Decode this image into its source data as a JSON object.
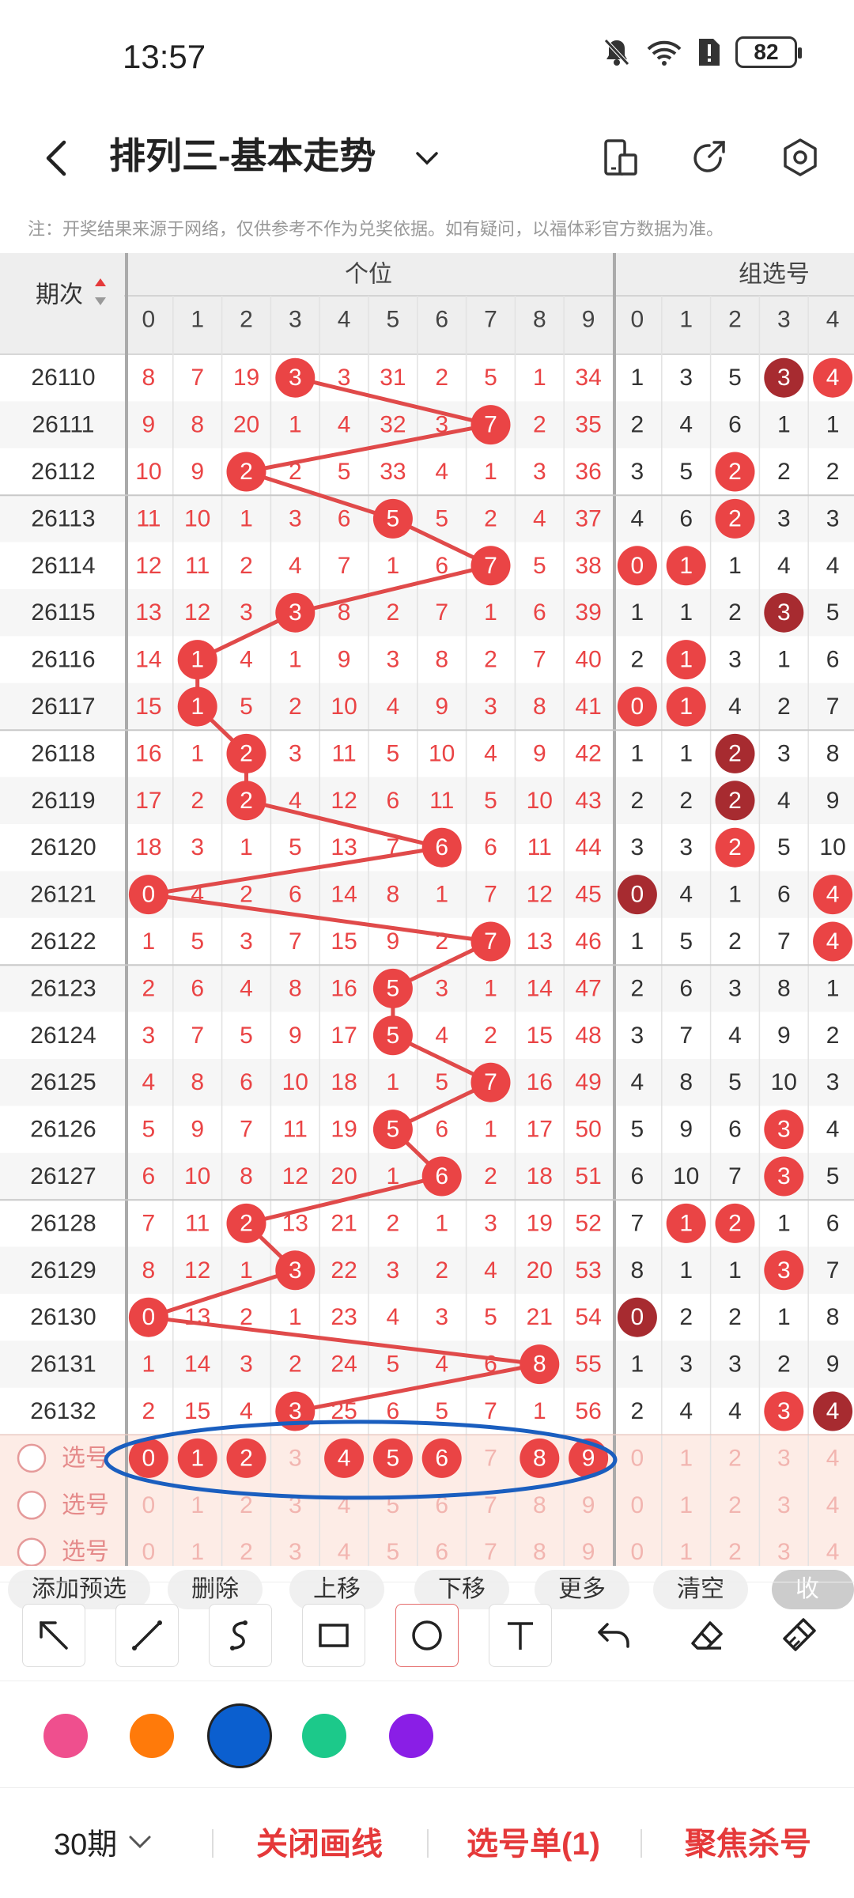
{
  "status": {
    "time": "13:57",
    "battery": "82"
  },
  "header": {
    "title": "排列三-基本走势"
  },
  "note": "注：开奖结果来源于网络，仅供参考不作为兑奖依据。如有疑问，以福体彩官方数据为准。",
  "table": {
    "period_header": "期次",
    "group_units": "个位",
    "group_combo": "组选号",
    "digit_headers": [
      "0",
      "1",
      "2",
      "3",
      "4",
      "5",
      "6",
      "7",
      "8",
      "9"
    ],
    "combo_headers": [
      "0",
      "1",
      "2",
      "3",
      "4"
    ],
    "rows": [
      {
        "period": "26110",
        "units": [
          "8",
          "7",
          "19",
          "3",
          "3",
          "31",
          "2",
          "5",
          "1",
          "34"
        ],
        "hit": 3,
        "combo": [
          "1",
          "3",
          "5",
          "3",
          "4"
        ],
        "combo_hits": [
          3,
          4
        ],
        "combo_dark": [
          3
        ]
      },
      {
        "period": "26111",
        "units": [
          "9",
          "8",
          "20",
          "1",
          "4",
          "32",
          "3",
          "7",
          "2",
          "35"
        ],
        "hit": 7,
        "combo": [
          "2",
          "4",
          "6",
          "1",
          "1"
        ],
        "combo_hits": [],
        "combo_dark": []
      },
      {
        "period": "26112",
        "units": [
          "10",
          "9",
          "2",
          "2",
          "5",
          "33",
          "4",
          "1",
          "3",
          "36"
        ],
        "hit": 2,
        "combo": [
          "3",
          "5",
          "2",
          "2",
          "2"
        ],
        "combo_hits": [
          2
        ],
        "combo_dark": []
      },
      {
        "period": "26113",
        "units": [
          "11",
          "10",
          "1",
          "3",
          "6",
          "5",
          "5",
          "2",
          "4",
          "37"
        ],
        "hit": 5,
        "combo": [
          "4",
          "6",
          "2",
          "3",
          "3"
        ],
        "combo_hits": [
          2
        ],
        "combo_dark": []
      },
      {
        "period": "26114",
        "units": [
          "12",
          "11",
          "2",
          "4",
          "7",
          "1",
          "6",
          "7",
          "5",
          "38"
        ],
        "hit": 7,
        "combo": [
          "0",
          "1",
          "1",
          "4",
          "4"
        ],
        "combo_hits": [
          0,
          1
        ],
        "combo_dark": []
      },
      {
        "period": "26115",
        "units": [
          "13",
          "12",
          "3",
          "3",
          "8",
          "2",
          "7",
          "1",
          "6",
          "39"
        ],
        "hit": 3,
        "combo": [
          "1",
          "1",
          "2",
          "3",
          "5"
        ],
        "combo_hits": [
          3
        ],
        "combo_dark": [
          3
        ]
      },
      {
        "period": "26116",
        "units": [
          "14",
          "1",
          "4",
          "1",
          "9",
          "3",
          "8",
          "2",
          "7",
          "40"
        ],
        "hit": 1,
        "combo": [
          "2",
          "1",
          "3",
          "1",
          "6"
        ],
        "combo_hits": [
          1
        ],
        "combo_dark": []
      },
      {
        "period": "26117",
        "units": [
          "15",
          "1",
          "5",
          "2",
          "10",
          "4",
          "9",
          "3",
          "8",
          "41"
        ],
        "hit": 1,
        "combo": [
          "0",
          "1",
          "4",
          "2",
          "7"
        ],
        "combo_hits": [
          0,
          1
        ],
        "combo_dark": []
      },
      {
        "period": "26118",
        "units": [
          "16",
          "1",
          "2",
          "3",
          "11",
          "5",
          "10",
          "4",
          "9",
          "42"
        ],
        "hit": 2,
        "combo": [
          "1",
          "1",
          "2",
          "3",
          "8"
        ],
        "combo_hits": [
          2
        ],
        "combo_dark": [
          2
        ]
      },
      {
        "period": "26119",
        "units": [
          "17",
          "2",
          "2",
          "4",
          "12",
          "6",
          "11",
          "5",
          "10",
          "43"
        ],
        "hit": 2,
        "combo": [
          "2",
          "2",
          "2",
          "4",
          "9"
        ],
        "combo_hits": [
          2
        ],
        "combo_dark": [
          2
        ]
      },
      {
        "period": "26120",
        "units": [
          "18",
          "3",
          "1",
          "5",
          "13",
          "7",
          "6",
          "6",
          "11",
          "44"
        ],
        "hit": 6,
        "combo": [
          "3",
          "3",
          "2",
          "5",
          "10"
        ],
        "combo_hits": [
          2
        ],
        "combo_dark": []
      },
      {
        "period": "26121",
        "units": [
          "0",
          "4",
          "2",
          "6",
          "14",
          "8",
          "1",
          "7",
          "12",
          "45"
        ],
        "hit": 0,
        "combo": [
          "0",
          "4",
          "1",
          "6",
          "4"
        ],
        "combo_hits": [
          0,
          4
        ],
        "combo_dark": [
          0
        ]
      },
      {
        "period": "26122",
        "units": [
          "1",
          "5",
          "3",
          "7",
          "15",
          "9",
          "2",
          "7",
          "13",
          "46"
        ],
        "hit": 7,
        "combo": [
          "1",
          "5",
          "2",
          "7",
          "4"
        ],
        "combo_hits": [
          4
        ],
        "combo_dark": []
      },
      {
        "period": "26123",
        "units": [
          "2",
          "6",
          "4",
          "8",
          "16",
          "5",
          "3",
          "1",
          "14",
          "47"
        ],
        "hit": 5,
        "combo": [
          "2",
          "6",
          "3",
          "8",
          "1"
        ],
        "combo_hits": [],
        "combo_dark": []
      },
      {
        "period": "26124",
        "units": [
          "3",
          "7",
          "5",
          "9",
          "17",
          "5",
          "4",
          "2",
          "15",
          "48"
        ],
        "hit": 5,
        "combo": [
          "3",
          "7",
          "4",
          "9",
          "2"
        ],
        "combo_hits": [],
        "combo_dark": []
      },
      {
        "period": "26125",
        "units": [
          "4",
          "8",
          "6",
          "10",
          "18",
          "1",
          "5",
          "7",
          "16",
          "49"
        ],
        "hit": 7,
        "combo": [
          "4",
          "8",
          "5",
          "10",
          "3"
        ],
        "combo_hits": [],
        "combo_dark": []
      },
      {
        "period": "26126",
        "units": [
          "5",
          "9",
          "7",
          "11",
          "19",
          "5",
          "6",
          "1",
          "17",
          "50"
        ],
        "hit": 5,
        "combo": [
          "5",
          "9",
          "6",
          "3",
          "4"
        ],
        "combo_hits": [
          3
        ],
        "combo_dark": []
      },
      {
        "period": "26127",
        "units": [
          "6",
          "10",
          "8",
          "12",
          "20",
          "1",
          "6",
          "2",
          "18",
          "51"
        ],
        "hit": 6,
        "combo": [
          "6",
          "10",
          "7",
          "3",
          "5"
        ],
        "combo_hits": [
          3
        ],
        "combo_dark": []
      },
      {
        "period": "26128",
        "units": [
          "7",
          "11",
          "2",
          "13",
          "21",
          "2",
          "1",
          "3",
          "19",
          "52"
        ],
        "hit": 2,
        "combo": [
          "7",
          "1",
          "2",
          "1",
          "6"
        ],
        "combo_hits": [
          1,
          2
        ],
        "combo_dark": []
      },
      {
        "period": "26129",
        "units": [
          "8",
          "12",
          "1",
          "3",
          "22",
          "3",
          "2",
          "4",
          "20",
          "53"
        ],
        "hit": 3,
        "combo": [
          "8",
          "1",
          "1",
          "3",
          "7"
        ],
        "combo_hits": [
          3
        ],
        "combo_dark": []
      },
      {
        "period": "26130",
        "units": [
          "0",
          "13",
          "2",
          "1",
          "23",
          "4",
          "3",
          "5",
          "21",
          "54"
        ],
        "hit": 0,
        "combo": [
          "0",
          "2",
          "2",
          "1",
          "8"
        ],
        "combo_hits": [
          0
        ],
        "combo_dark": [
          0
        ]
      },
      {
        "period": "26131",
        "units": [
          "1",
          "14",
          "3",
          "2",
          "24",
          "5",
          "4",
          "6",
          "8",
          "55"
        ],
        "hit": 8,
        "combo": [
          "1",
          "3",
          "3",
          "2",
          "9"
        ],
        "combo_hits": [],
        "combo_dark": []
      },
      {
        "period": "26132",
        "units": [
          "2",
          "15",
          "4",
          "3",
          "25",
          "6",
          "5",
          "7",
          "1",
          "56"
        ],
        "hit": 3,
        "combo": [
          "2",
          "4",
          "4",
          "3",
          "4"
        ],
        "combo_hits": [
          3,
          4
        ],
        "combo_dark": [
          4
        ]
      }
    ],
    "select_label": "选号",
    "select_rows": [
      {
        "units_selected": [
          0,
          1,
          2,
          4,
          5,
          6,
          8,
          9
        ]
      },
      {
        "units_selected": []
      },
      {
        "units_selected": []
      }
    ]
  },
  "chips": [
    "添加预选",
    "删除",
    "上移",
    "下移",
    "更多",
    "清空",
    "收起"
  ],
  "bottom": {
    "period": "30期",
    "close_draw": "关闭画线",
    "ticket": "选号单(1)",
    "focus": "聚焦杀号"
  },
  "colors": {
    "red": "#ea4445",
    "dark_red": "#a72b30",
    "line": "#e04a4a",
    "blue": "#1a5ebf"
  },
  "swatches": [
    "#ef4f8e",
    "#ff7a0a",
    "#0b5fcf",
    "#1cc98a",
    "#8a1ee6"
  ],
  "tools": [
    "arrow-tool-icon",
    "line-tool-icon",
    "curve-tool-icon",
    "rect-tool-icon",
    "circle-tool-icon",
    "text-tool-icon",
    "undo-icon",
    "eraser-icon",
    "clear-brush-icon"
  ]
}
